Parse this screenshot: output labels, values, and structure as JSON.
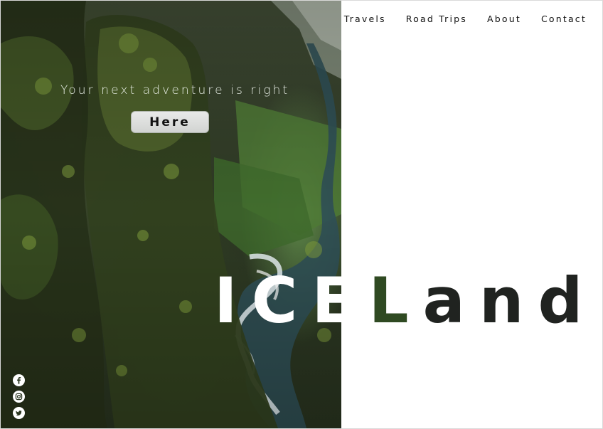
{
  "nav": {
    "items": [
      {
        "label": "Travels"
      },
      {
        "label": "Road Trips"
      },
      {
        "label": "About"
      },
      {
        "label": "Contact"
      }
    ]
  },
  "hero": {
    "tagline": "Your next adventure is right",
    "cta_label": "Here",
    "brand": {
      "part1": "ICE",
      "part2": "L",
      "part3": "and"
    }
  },
  "social": {
    "icons": [
      "facebook-icon",
      "instagram-icon",
      "twitter-icon"
    ]
  },
  "colors": {
    "text_dark": "#111111",
    "tagline": "#e9efe7",
    "button_bg": "#d9dad9"
  }
}
